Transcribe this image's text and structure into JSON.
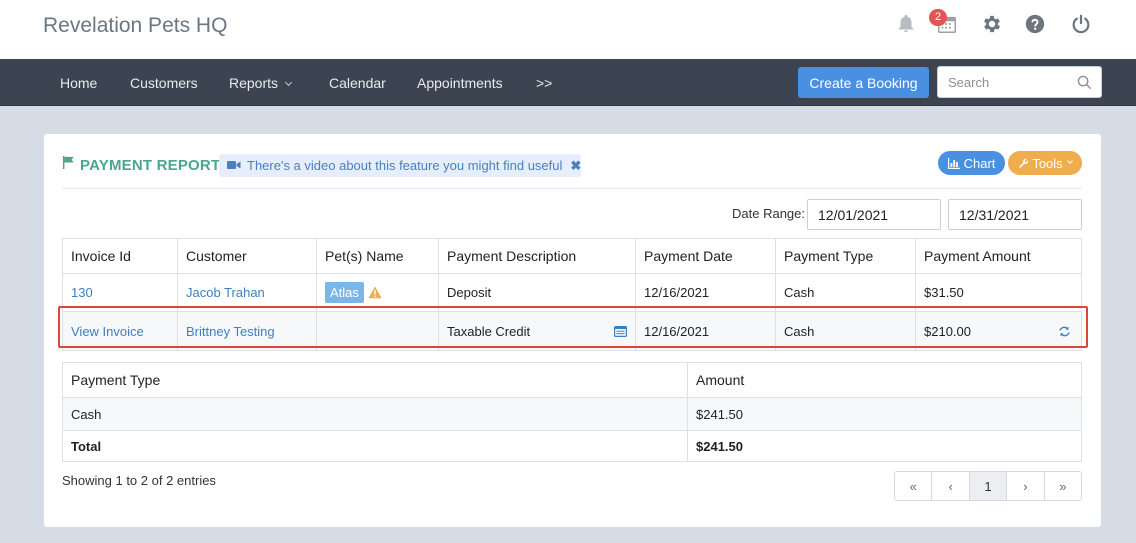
{
  "app": {
    "title": "Revelation Pets HQ",
    "notification_count": "2"
  },
  "nav": {
    "items": [
      "Home",
      "Customers",
      "Reports",
      "Calendar",
      "Appointments",
      ">>"
    ],
    "create_booking": "Create a Booking",
    "search_placeholder": "Search"
  },
  "report": {
    "title": "PAYMENT REPORT",
    "video_banner": "There's a video about this feature you might find useful",
    "chart_label": "Chart",
    "tools_label": "Tools",
    "date_range_label": "Date Range:",
    "date_from": "12/01/2021",
    "date_to": "12/31/2021"
  },
  "payments": {
    "headers": [
      "Invoice Id",
      "Customer",
      "Pet(s) Name",
      "Payment Description",
      "Payment Date",
      "Payment Type",
      "Payment Amount"
    ],
    "rows": [
      {
        "invoice": "130",
        "customer": "Jacob Trahan",
        "pet": "Atlas",
        "description": "Deposit",
        "date": "12/16/2021",
        "type": "Cash",
        "amount": "$31.50"
      },
      {
        "invoice": "View Invoice",
        "customer": "Brittney Testing",
        "pet": "",
        "description": "Taxable Credit",
        "date": "12/16/2021",
        "type": "Cash",
        "amount": "$210.00"
      }
    ]
  },
  "summary": {
    "headers": [
      "Payment Type",
      "Amount"
    ],
    "rows": [
      {
        "type": "Cash",
        "amount": "$241.50"
      },
      {
        "type": "Total",
        "amount": "$241.50"
      }
    ]
  },
  "footer": {
    "entries": "Showing 1 to 2 of 2 entries",
    "pager": [
      "«",
      "‹",
      "1",
      "›",
      "»"
    ]
  },
  "icons": [
    "bell-icon",
    "calendar-icon",
    "gear-icon",
    "help-icon",
    "power-icon",
    "search-icon",
    "flag-icon",
    "video-icon",
    "close-icon",
    "bar-chart-icon",
    "wrench-icon",
    "warning-icon",
    "notes-icon",
    "refresh-icon"
  ],
  "colors": {
    "accent": "#4a90e2",
    "title_green": "#4aa68f",
    "tools_orange": "#f0ad4e",
    "highlight_red": "#d9473a",
    "warning": "#f0ad4e"
  }
}
